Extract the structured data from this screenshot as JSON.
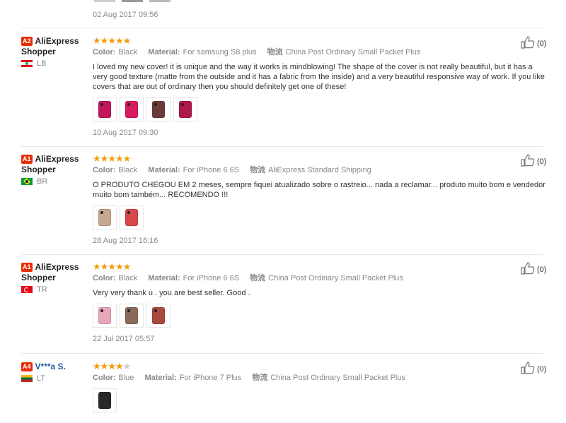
{
  "top_date": "02 Aug 2017 09:56",
  "labels": {
    "color": "Color:",
    "material": "Material:",
    "shipping_icon": "物流"
  },
  "reviews": [
    {
      "level": "A2",
      "name": "AliExpress Shopper",
      "country": "LB",
      "flag": "lb",
      "stars": 5,
      "color": "Black",
      "material": "For samsung S8 plus",
      "shipping": "China Post Ordinary Small Packet Plus",
      "text": "I loved my new cover! it is unique and the way it works is mindblowing! The shape of the cover is not really beautiful, but it has a very good texture (matte from the outside and it has a fabric from the inside) and a very beautiful responsive way of work. If you like covers that are out of ordinary then you should definitely get one of these!",
      "photo_colors": [
        "#c2185b",
        "#d81b60",
        "#6d3a3a",
        "#b0174a"
      ],
      "date": "10 Aug 2017 09:30",
      "likes": "(0)"
    },
    {
      "level": "A1",
      "name": "AliExpress Shopper",
      "country": "BR",
      "flag": "br",
      "stars": 5,
      "color": "Black",
      "material": "For iPhone 6 6S",
      "shipping": "AliExpress Standard Shipping",
      "text": "O PRODUTO CHEGOU EM 2 meses, sempre fiquei atualizado sobre o rastreio... nada a reclamar... produto muito bom e vendedor muito bom também... RECOMENDO !!!",
      "photo_colors": [
        "#c9a892",
        "#d84848"
      ],
      "date": "28 Aug 2017 16:16",
      "likes": "(0)"
    },
    {
      "level": "A1",
      "name": "AliExpress Shopper",
      "country": "TR",
      "flag": "tr",
      "stars": 5,
      "color": "Black",
      "material": "For iPhone 6 6S",
      "shipping": "China Post Ordinary Small Packet Plus",
      "text": "Very very thank u . you are best seller. Good .",
      "photo_colors": [
        "#e8a7b8",
        "#8a6a58",
        "#a84a3c"
      ],
      "date": "22 Jul 2017 05:57",
      "likes": "(0)"
    },
    {
      "level": "A4",
      "name": "V***a S.",
      "country": "LT",
      "flag": "lt",
      "stars": 4,
      "color": "Blue",
      "material": "For iPhone 7 Plus",
      "shipping": "China Post Ordinary Small Packet Plus",
      "text": "",
      "photo_colors": [
        "#2a2a2a"
      ],
      "date": "",
      "likes": "(0)"
    }
  ]
}
